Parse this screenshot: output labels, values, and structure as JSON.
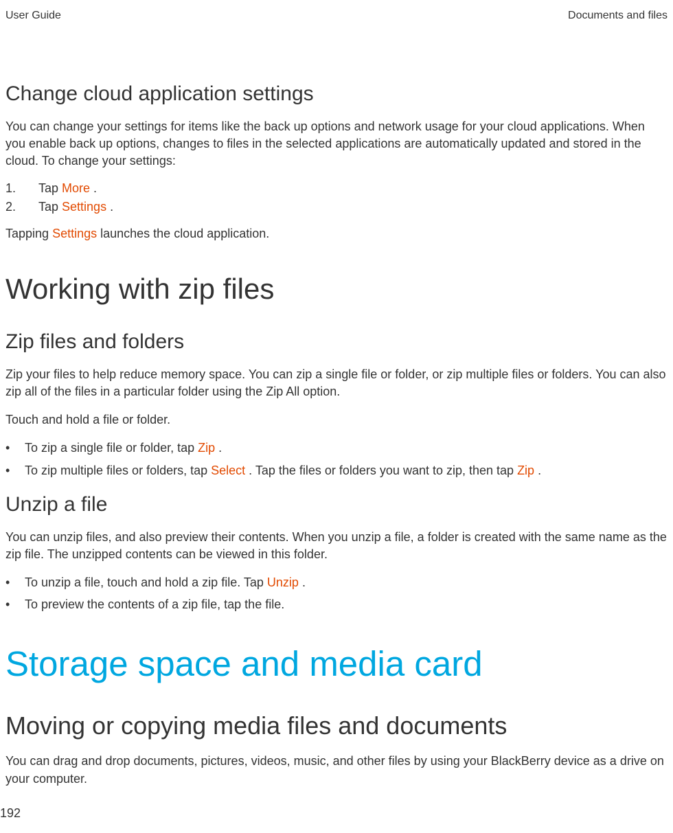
{
  "header": {
    "left": "User Guide",
    "right": "Documents and files"
  },
  "section1": {
    "title": "Change cloud application settings",
    "para1": "You can change your settings for items like the back up options and network usage for your cloud applications. When you enable back up options, changes to files in the selected applications are automatically updated and stored in the cloud. To change your settings:",
    "list": {
      "item1_num": "1.",
      "item1_before": "Tap  ",
      "item1_link": "More",
      "item1_after": " .",
      "item2_num": "2.",
      "item2_before": "Tap  ",
      "item2_link": "Settings",
      "item2_after": " ."
    },
    "para2_before": "Tapping  ",
    "para2_link": "Settings",
    "para2_after": "  launches the cloud application."
  },
  "section2": {
    "title": "Working with zip files",
    "sub1": {
      "title": "Zip files and folders",
      "para1": "Zip your files to help reduce memory space. You can zip a single file or folder, or zip multiple files or folders. You can also zip all of the files in a particular folder using the Zip All option.",
      "para2": "Touch and hold a file or folder.",
      "list": {
        "item1_before": "To zip a single file or folder, tap  ",
        "item1_link": "Zip",
        "item1_after": " .",
        "item2_before": "To zip multiple files or folders, tap  ",
        "item2_link1": "Select",
        "item2_mid": " . Tap the files or folders you want to zip, then tap  ",
        "item2_link2": "Zip",
        "item2_after": " ."
      }
    },
    "sub2": {
      "title": "Unzip a file",
      "para1": "You can unzip files, and also preview their contents. When you unzip a file, a folder is created with the same name as the zip file. The unzipped contents can be viewed in this folder.",
      "list": {
        "item1_before": "To unzip a file, touch and hold a zip file. Tap  ",
        "item1_link": "Unzip",
        "item1_after": " .",
        "item2": "To preview the contents of a zip file, tap the file."
      }
    }
  },
  "section3": {
    "title": "Storage space and media card",
    "sub1": {
      "title": "Moving or copying media files and documents",
      "para1": "You can drag and drop documents, pictures, videos, music, and other files by using your BlackBerry device as a drive on your computer."
    }
  },
  "pageNumber": "192",
  "bullet": "•"
}
